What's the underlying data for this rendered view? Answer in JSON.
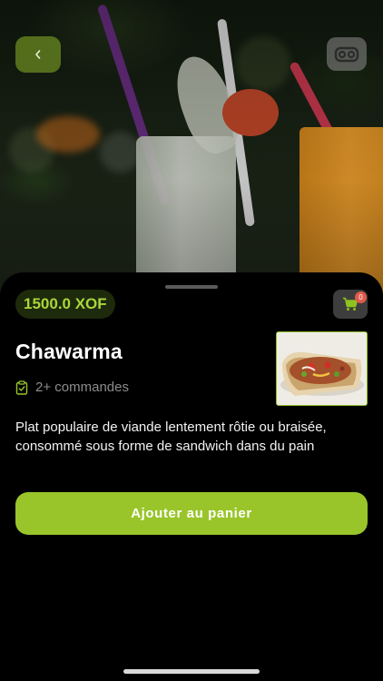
{
  "header": {
    "back_icon": "chevron-left-icon",
    "vr_icon": "vr-headset-icon"
  },
  "product": {
    "price": "1500.0 XOF",
    "name": "Chawarma",
    "orders_icon": "clipboard-check-icon",
    "orders": "2+ commandes",
    "description": "Plat populaire de viande lentement rôtie ou braisée, consommé sous forme de sandwich dans du pain"
  },
  "cart": {
    "icon": "shopping-cart-icon",
    "count": "0"
  },
  "actions": {
    "add_to_cart_label": "Ajouter au panier"
  },
  "colors": {
    "accent": "#99c52a",
    "price_text": "#a9d63b",
    "badge": "#e25a4a",
    "background": "#000000"
  }
}
